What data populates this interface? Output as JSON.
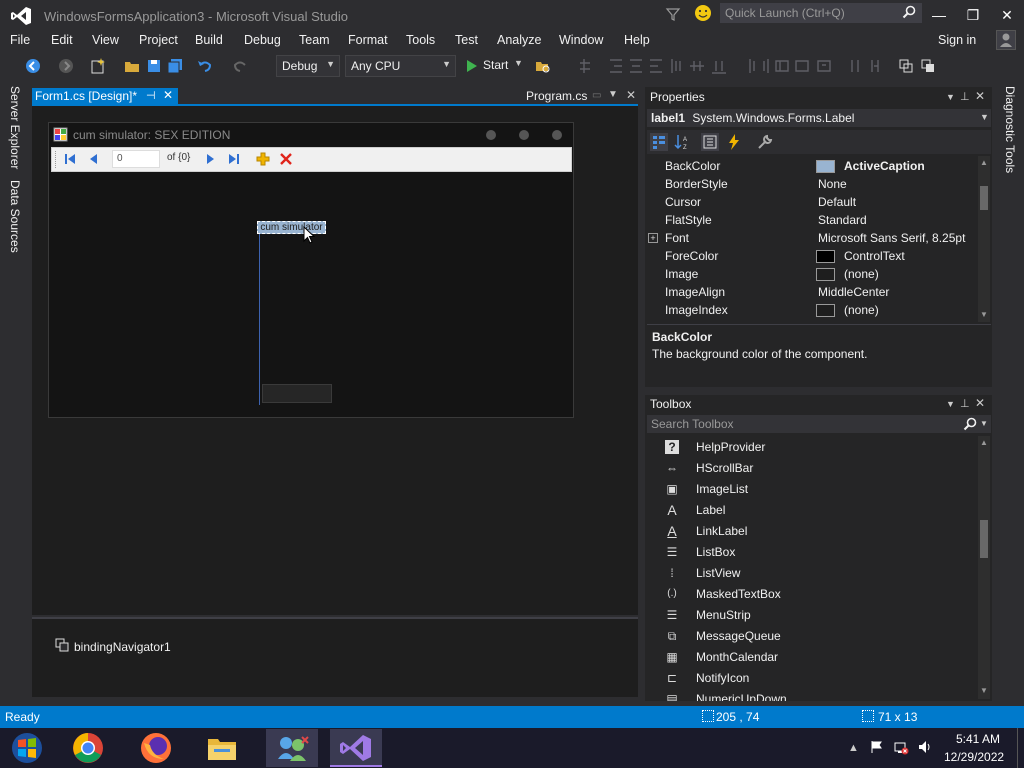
{
  "window": {
    "title": "WindowsFormsApplication3 - Microsoft Visual Studio",
    "quick_launch_placeholder": "Quick Launch (Ctrl+Q)",
    "min": "—",
    "restore": "❐",
    "close": "✕"
  },
  "menu": [
    "File",
    "Edit",
    "View",
    "Project",
    "Build",
    "Debug",
    "Team",
    "Format",
    "Tools",
    "Test",
    "Analyze",
    "Window",
    "Help"
  ],
  "signin": "Sign in",
  "toolbar": {
    "config": "Debug",
    "platform": "Any CPU",
    "start": "Start"
  },
  "left_strip": [
    "Server Explorer",
    "Data Sources"
  ],
  "right_strip": [
    "Diagnostic Tools"
  ],
  "tabs": {
    "active": "Form1.cs [Design]*",
    "other": "Program.cs"
  },
  "form": {
    "title": "cum simulator: SEX EDITION",
    "nav_position": "0",
    "nav_count": "of {0}",
    "label_text": "cum simulator"
  },
  "tray": {
    "component": "bindingNavigator1"
  },
  "properties": {
    "title": "Properties",
    "object": "label1",
    "object_type": "System.Windows.Forms.Label",
    "rows": [
      {
        "name": "BackColor",
        "value": "ActiveCaption",
        "swatch": "#99b4d1"
      },
      {
        "name": "BorderStyle",
        "value": "None"
      },
      {
        "name": "Cursor",
        "value": "Default"
      },
      {
        "name": "FlatStyle",
        "value": "Standard"
      },
      {
        "name": "Font",
        "value": "Microsoft Sans Serif, 8.25pt"
      },
      {
        "name": "ForeColor",
        "value": "ControlText",
        "swatch": "#000000"
      },
      {
        "name": "Image",
        "value": "(none)",
        "swatch": "#1e1e1e"
      },
      {
        "name": "ImageAlign",
        "value": "MiddleCenter"
      },
      {
        "name": "ImageIndex",
        "value": "(none)",
        "swatch": "#1e1e1e"
      }
    ],
    "desc_title": "BackColor",
    "desc_text": "The background color of the component."
  },
  "toolbox": {
    "title": "Toolbox",
    "search_placeholder": "Search Toolbox",
    "items": [
      {
        "icon": "?",
        "label": "HelpProvider"
      },
      {
        "icon": "⇔",
        "label": "HScrollBar"
      },
      {
        "icon": "▣",
        "label": "ImageList"
      },
      {
        "icon": "A",
        "label": "Label"
      },
      {
        "icon": "A",
        "label": "LinkLabel"
      },
      {
        "icon": "☰",
        "label": "ListBox"
      },
      {
        "icon": "⁞",
        "label": "ListView"
      },
      {
        "icon": "(.)",
        "label": "MaskedTextBox"
      },
      {
        "icon": "☰",
        "label": "MenuStrip"
      },
      {
        "icon": "⧉",
        "label": "MessageQueue"
      },
      {
        "icon": "▦",
        "label": "MonthCalendar"
      },
      {
        "icon": "⊏",
        "label": "NotifyIcon"
      },
      {
        "icon": "▤",
        "label": "NumericUpDown"
      }
    ]
  },
  "status": {
    "ready": "Ready",
    "position": "205 , 74",
    "size": "71 x 13"
  },
  "taskbar": {
    "time": "5:41 AM",
    "date": "12/29/2022"
  },
  "colors": {
    "accent": "#007acc",
    "label_backcolor": "#99b4d1"
  }
}
